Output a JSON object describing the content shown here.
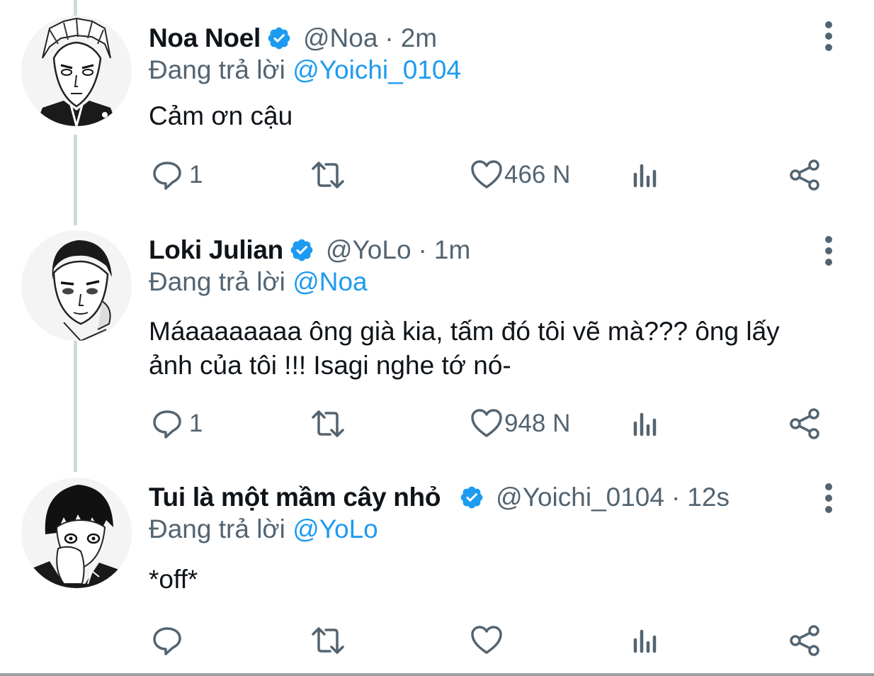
{
  "colors": {
    "text": "#0f1419",
    "secondary": "#536471",
    "mention": "#1d9bf0",
    "verified": "#1d9bf0",
    "thread_line": "#cfd9de"
  },
  "tweets": [
    {
      "display_name": "Noa Noel",
      "handle": "@Noa",
      "time": "2m",
      "reply_prefix": "Đang trả lời ",
      "reply_to": "@Yoichi_0104",
      "text": "Cảm ơn cậu",
      "replies": "1",
      "retweets": "",
      "likes": "466 N",
      "avatar_icon": "avatar-noa-noel"
    },
    {
      "display_name": "Loki Julian",
      "handle": "@YoLo",
      "time": "1m",
      "reply_prefix": "Đang trả lời ",
      "reply_to": "@Noa",
      "text": "Máaaaaaaaa ông già kia, tấm đó tôi vẽ mà??? ông lấy ảnh của tôi !!! Isagi nghe tớ nó-",
      "replies": "1",
      "retweets": "",
      "likes": "948 N",
      "avatar_icon": "avatar-loki-julian"
    },
    {
      "display_name": "Tui là một mầm cây nhỏ",
      "handle": "@Yoichi_0104",
      "time": "12s",
      "reply_prefix": "Đang trả lời ",
      "reply_to": "@YoLo",
      "text": "*off*",
      "replies": "",
      "retweets": "",
      "likes": "",
      "avatar_icon": "avatar-yoichi"
    }
  ],
  "separator": "·",
  "icons": {
    "reply": "reply-icon",
    "retweet": "retweet-icon",
    "like": "heart-icon",
    "views": "analytics-icon",
    "share": "share-icon",
    "more": "more-vertical-icon",
    "verified": "verified-badge-icon"
  }
}
